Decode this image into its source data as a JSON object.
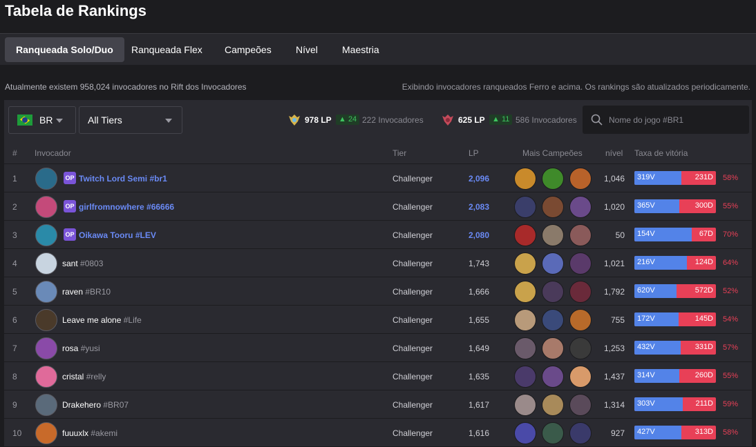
{
  "page": {
    "title": "Tabela de Rankings"
  },
  "tabs": [
    {
      "label": "Ranqueada Solo/Duo",
      "active": true
    },
    {
      "label": "Ranqueada Flex",
      "active": false
    },
    {
      "label": "Campeões",
      "active": false
    },
    {
      "label": "Nível",
      "active": false
    },
    {
      "label": "Maestria",
      "active": false
    }
  ],
  "info": {
    "left": "Atualmente existem 958,024 invocadores no Rift dos Invocadores",
    "right": "Exibindo invocadores ranqueados Ferro e acima. Os rankings são atualizados periodicamente."
  },
  "filters": {
    "region": "BR",
    "tier": "All Tiers",
    "search_placeholder": "Nome do jogo #BR1"
  },
  "cutoffs": [
    {
      "lp": "978 LP",
      "delta": "▲ 24",
      "count": "222 Invocadores",
      "color": "#d6b44b"
    },
    {
      "lp": "625 LP",
      "delta": "▲ 11",
      "count": "586 Invocadores",
      "color": "#c44a5a"
    }
  ],
  "columns": {
    "rank": "#",
    "summoner": "Invocador",
    "tier": "Tier",
    "lp": "LP",
    "champions": "Mais Campeões",
    "level": "nível",
    "winrate": "Taxa de vitória"
  },
  "colors": {
    "win": "#5383e8",
    "loss": "#e84057",
    "pro": "#6a8af5",
    "op_badge": "#7a54d8"
  },
  "rows": [
    {
      "rank": "1",
      "name": "Twitch Lord Semi",
      "tag": "#br1",
      "pro": true,
      "badge": "OP",
      "tier": "Challenger",
      "lp": "2,096",
      "level": "1,046",
      "wins": "319V",
      "losses": "231D",
      "win_fraction": 0.58,
      "rate": "58%",
      "avatar": "#2a6b8a",
      "champs": [
        "#c98a2b",
        "#3f8a2a",
        "#b8622a"
      ]
    },
    {
      "rank": "2",
      "name": "girlfromnowhere",
      "tag": "#66666",
      "pro": true,
      "badge": "OP",
      "tier": "Challenger",
      "lp": "2,083",
      "level": "1,020",
      "wins": "365V",
      "losses": "300D",
      "win_fraction": 0.55,
      "rate": "55%",
      "avatar": "#c44a7a",
      "champs": [
        "#3a3e6a",
        "#7a4a32",
        "#6a4a8a"
      ]
    },
    {
      "rank": "3",
      "name": "Oikawa Tooru",
      "tag": "#LEV",
      "pro": true,
      "badge": "OP",
      "tier": "Challenger",
      "lp": "2,080",
      "level": "50",
      "wins": "154V",
      "losses": "67D",
      "win_fraction": 0.7,
      "rate": "70%",
      "avatar": "#2a8aa8",
      "champs": [
        "#a82a2a",
        "#8a7a6a",
        "#8a5a5a"
      ]
    },
    {
      "rank": "4",
      "name": "sant",
      "tag": "#0803",
      "pro": false,
      "badge": "",
      "tier": "Challenger",
      "lp": "1,743",
      "level": "1,021",
      "wins": "216V",
      "losses": "124D",
      "win_fraction": 0.64,
      "rate": "64%",
      "avatar": "#c8d4e0",
      "champs": [
        "#c9a24b",
        "#5a6ab8",
        "#5a3a6a"
      ]
    },
    {
      "rank": "5",
      "name": "raven",
      "tag": "#BR10",
      "pro": false,
      "badge": "",
      "tier": "Challenger",
      "lp": "1,666",
      "level": "1,792",
      "wins": "620V",
      "losses": "572D",
      "win_fraction": 0.52,
      "rate": "52%",
      "avatar": "#6a8ab8",
      "champs": [
        "#c9a24b",
        "#4a3a5a",
        "#6a2a3a"
      ]
    },
    {
      "rank": "6",
      "name": "Leave me alone",
      "tag": "#Life",
      "pro": false,
      "badge": "",
      "tier": "Challenger",
      "lp": "1,655",
      "level": "755",
      "wins": "172V",
      "losses": "145D",
      "win_fraction": 0.54,
      "rate": "54%",
      "avatar": "#4a3a2a",
      "champs": [
        "#b89a7a",
        "#3a4a7a",
        "#b86a2a"
      ]
    },
    {
      "rank": "7",
      "name": "rosa",
      "tag": "#yusi",
      "pro": false,
      "badge": "",
      "tier": "Challenger",
      "lp": "1,649",
      "level": "1,253",
      "wins": "432V",
      "losses": "331D",
      "win_fraction": 0.57,
      "rate": "57%",
      "avatar": "#8a4aa8",
      "champs": [
        "#6a5a6a",
        "#a87a6a",
        "#3a3a3a"
      ]
    },
    {
      "rank": "8",
      "name": "cristal",
      "tag": "#relly",
      "pro": false,
      "badge": "",
      "tier": "Challenger",
      "lp": "1,635",
      "level": "1,437",
      "wins": "314V",
      "losses": "260D",
      "win_fraction": 0.55,
      "rate": "55%",
      "avatar": "#e06a9a",
      "champs": [
        "#4a3a6a",
        "#6a4a8a",
        "#d89a6a"
      ]
    },
    {
      "rank": "9",
      "name": "Drakehero",
      "tag": "#BR07",
      "pro": false,
      "badge": "",
      "tier": "Challenger",
      "lp": "1,617",
      "level": "1,314",
      "wins": "303V",
      "losses": "211D",
      "win_fraction": 0.59,
      "rate": "59%",
      "avatar": "#5a6a7a",
      "champs": [
        "#9a8a8a",
        "#a88a5a",
        "#5a4a5a"
      ]
    },
    {
      "rank": "10",
      "name": "fuuuxlx",
      "tag": "#akemi",
      "pro": false,
      "badge": "",
      "tier": "Challenger",
      "lp": "1,616",
      "level": "927",
      "wins": "427V",
      "losses": "313D",
      "win_fraction": 0.58,
      "rate": "58%",
      "avatar": "#c86a2a",
      "champs": [
        "#4a4aa8",
        "#3a5a4a",
        "#3a3a6a"
      ]
    }
  ]
}
